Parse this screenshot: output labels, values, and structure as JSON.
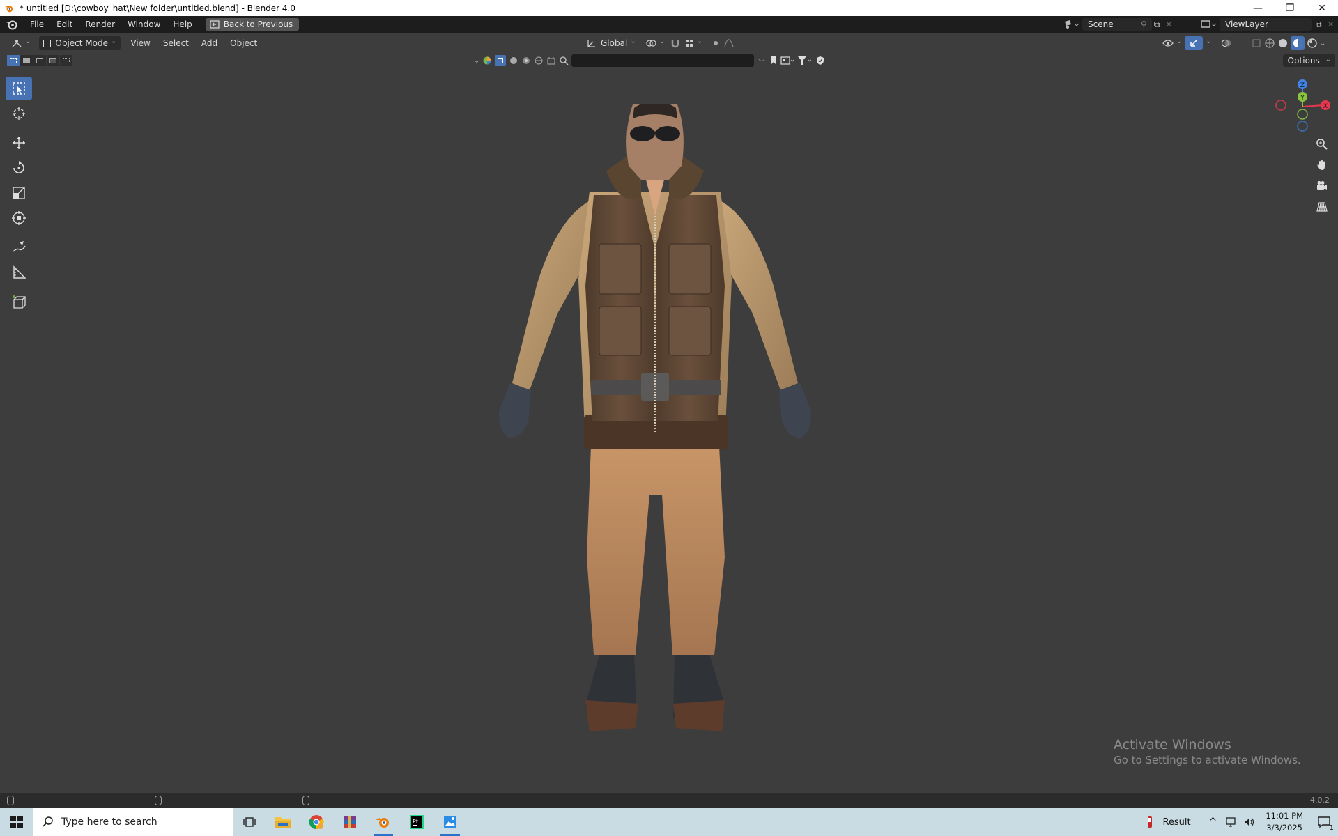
{
  "window": {
    "title": "* untitled [D:\\cowboy_hat\\New folder\\untitled.blend] - Blender 4.0",
    "controls": [
      "minimize",
      "restore",
      "close"
    ]
  },
  "menubar": {
    "items": [
      "File",
      "Edit",
      "Render",
      "Window",
      "Help"
    ],
    "back_button": "Back to Previous",
    "scene": "Scene",
    "view_layer": "ViewLayer"
  },
  "viewport_header": {
    "mode": "Object Mode",
    "menus": [
      "View",
      "Select",
      "Add",
      "Object"
    ],
    "orientation": "Global",
    "options": "Options"
  },
  "toolbar": {
    "tools": [
      "select-box",
      "cursor",
      "move",
      "rotate",
      "scale",
      "transform",
      "annotate",
      "measure",
      "add-cube"
    ],
    "active": "select-box"
  },
  "gizmo": {
    "axes": [
      "X",
      "Y",
      "Z"
    ],
    "colors": {
      "x": "#e8384f",
      "y": "#8ac43f",
      "z": "#3f86e8"
    }
  },
  "watermark": {
    "line1": "Activate Windows",
    "line2": "Go to Settings to activate Windows."
  },
  "statusbar": {
    "version": "4.0.2"
  },
  "taskbar": {
    "search_placeholder": "Type here to search",
    "apps": [
      "task-view",
      "file-explorer",
      "chrome",
      "winrar",
      "pycharm",
      "blender",
      "photos"
    ],
    "active_app": "blender",
    "tray_label": "Result",
    "time": "11:01 PM",
    "date": "3/3/2025",
    "notification_count": "1"
  }
}
